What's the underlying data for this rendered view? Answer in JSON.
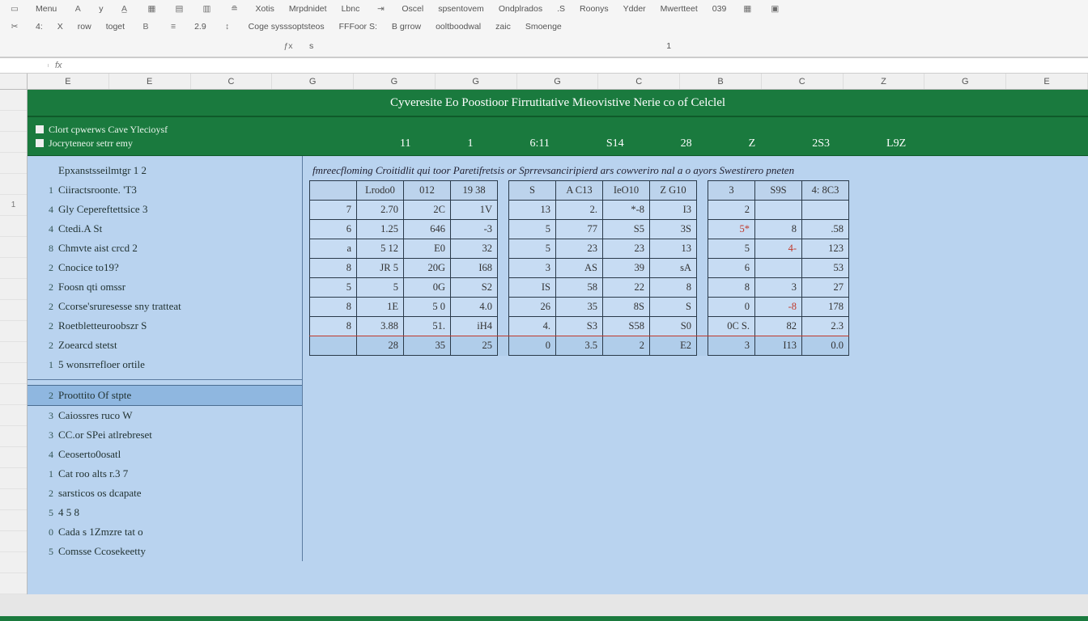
{
  "ribbon": {
    "row1": [
      "Menu",
      "y",
      "Xotis",
      "Mrpdnidet",
      "Lbnc",
      "Oscel",
      "spsentovem",
      "Ondplrados",
      ".S",
      "Roonys",
      "Ydder",
      "Mwertteet",
      "039"
    ],
    "row2": [
      "4:",
      "X",
      "row",
      "toget",
      "2.9",
      "Coge  sysssoptsteos",
      "FFFoor  S:",
      "B grrow",
      "ooltboodwal",
      "zaic",
      "Smoenge"
    ],
    "row3": [
      "s",
      "1"
    ]
  },
  "formula": {
    "name": "",
    "value": ""
  },
  "columns": [
    "E",
    "E",
    "C",
    "G",
    "G",
    "G",
    "G",
    "C",
    "B",
    "C",
    "Z",
    "G",
    "E"
  ],
  "row_nums": [
    "",
    "",
    "",
    "",
    "",
    "1",
    "",
    "",
    "",
    "",
    "",
    "",
    "",
    "",
    "",
    "",
    "",
    "",
    "",
    "",
    "",
    "",
    "",
    ""
  ],
  "title": "Cyveresite Eo Poostioor Firrutitative Mieovistive Nerie co of Celclel",
  "meta": {
    "line1": "Clort cpwerws Cave Ylecioysf",
    "line2": "Jocryteneor setrr emy",
    "headers": [
      "11",
      "1",
      "6:11",
      "S14",
      "28",
      "Z",
      "2S3",
      "L9Z"
    ]
  },
  "left_items_top": [
    {
      "n": "",
      "label": "Epxanstsseilmtgr 1  2"
    },
    {
      "n": "1",
      "label": "Ciiractsroonte. 'T3"
    },
    {
      "n": "4",
      "label": "Gly Cepereftettsice 3"
    },
    {
      "n": "4",
      "label": "Ctedi.A St"
    },
    {
      "n": "8",
      "label": "Chmvte aist crcd  2"
    },
    {
      "n": "2",
      "label": "Cnocice to19?"
    },
    {
      "n": "2",
      "label": "Foosn qti omssr"
    },
    {
      "n": "2",
      "label": "Ccorse'sruresesse sny tratteat"
    },
    {
      "n": "2",
      "label": "Roetbletteuroobszr S"
    },
    {
      "n": "2",
      "label": "Zoearcd stetst"
    },
    {
      "n": "1",
      "label": "5 wonsrrefloer ortile"
    }
  ],
  "left_items_bottom": [
    {
      "n": "2",
      "label": "Proottito Of stpte",
      "hl": true
    },
    {
      "n": "3",
      "label": "Caiossres ruco W"
    },
    {
      "n": "3",
      "label": "CC.or SPei atlrebreset"
    },
    {
      "n": "4",
      "label": "Ceoserto0osatl"
    },
    {
      "n": "1",
      "label": "Cat roo alts r.3 7"
    },
    {
      "n": "2",
      "label": "sarsticos os dcapate"
    },
    {
      "n": "5",
      "label": "4 5 8"
    },
    {
      "n": "0",
      "label": "Cada s 1Zmzre tat o"
    },
    {
      "n": "5",
      "label": "Comsse Ccosekeetty"
    }
  ],
  "table": {
    "headline": "fmreecfloming Croitidlit qui toor Paretifretsis or Sprrevsanciripierd ars cowveriro nal a o ayors Swestirero pneten",
    "headers": [
      "Lrodo0",
      "012",
      "19 38",
      "S",
      "A C13",
      "IeO10",
      "Z G10",
      "3",
      "S9S",
      "4: 8C3"
    ],
    "rows": [
      {
        "idx": "7",
        "cells": [
          "2.70",
          "2C",
          "1V",
          "13",
          "2.",
          "*-8",
          "I3",
          "2",
          "",
          ""
        ]
      },
      {
        "idx": "6",
        "cells": [
          "1.25",
          "646",
          "-3",
          "5",
          "77",
          "S5",
          "3S",
          "5*",
          "8",
          ".58"
        ]
      },
      {
        "idx": "a",
        "cells": [
          "5 12",
          "E0",
          "32",
          "5",
          "23",
          "23",
          "13",
          "5",
          "4-",
          "123"
        ]
      },
      {
        "idx": "8",
        "cells": [
          "JR 5",
          "20G",
          "I68",
          "3",
          "AS",
          "39",
          "sA",
          "6",
          "",
          "53"
        ]
      },
      {
        "idx": "5",
        "cells": [
          "5",
          "0G",
          "S2",
          "IS",
          "58",
          "22",
          "8",
          "8",
          "3",
          "27"
        ]
      },
      {
        "idx": "8",
        "cells": [
          "1E",
          "5 0",
          "4.0",
          "26",
          "35",
          "8S",
          "S",
          "0",
          "-8",
          "178"
        ]
      },
      {
        "idx": "8",
        "cells": [
          "3.88",
          "51.",
          "iH4",
          "4.",
          "S3",
          "S58",
          "S0",
          "0C S.",
          "82",
          "2.3"
        ],
        "redline": true
      }
    ],
    "total": [
      "28",
      "35",
      "25",
      "0",
      "3.5",
      "2",
      "E2",
      "3",
      "I13",
      "0.0"
    ]
  }
}
